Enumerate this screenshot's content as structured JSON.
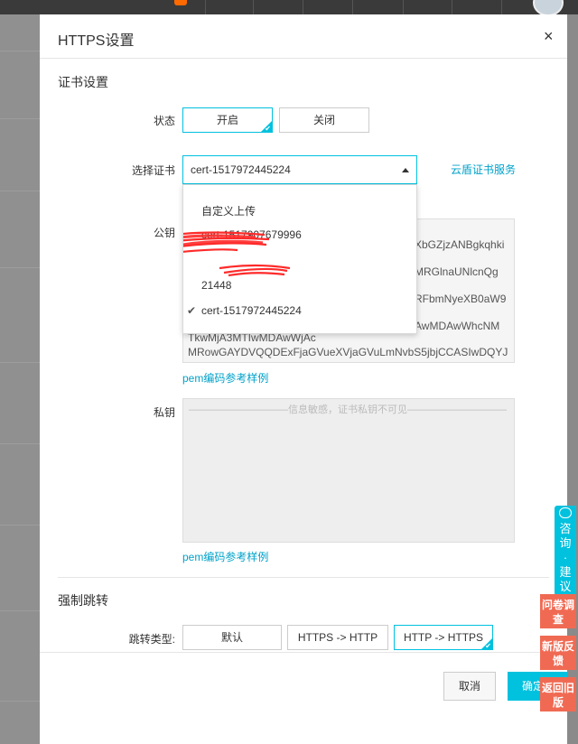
{
  "dialog": {
    "title": "HTTPS设置",
    "close_glyph": "×",
    "cert_section": "证书设置",
    "status_label": "状态",
    "status_on": "开启",
    "status_off": "关闭",
    "select_label": "选择证书",
    "selected_cert": "cert-1517972445224",
    "cloud_link": "云盾证书服务",
    "public_key_label": "公钥",
    "public_key_lines": [
      "XbGZjzANBgkqhki",
      "MRGlnaUNlcnQg",
      "RFbmNyeXB0aW9",
      "AwMDAwWhcNM",
      "TkwMjA3MTIwMDAwWjAc",
      "MRowGAYDVQQDExFjaGVueXVjaGVuLmNvbS5jbjCCASIwDQYJ"
    ],
    "pem_link_1": "pem编码参考样例",
    "private_key_label": "私钥",
    "private_key_placeholder": "——————————信息敏感，证书私钥不可见——————————",
    "pem_link_2": "pem编码参考样例",
    "redirect_section": "强制跳转",
    "redirect_label": "跳转类型:",
    "redirect_default": "默认",
    "redirect_https_http": "HTTPS -> HTTP",
    "redirect_http_https": "HTTP -> HTTPS",
    "cancel": "取消",
    "confirm": "确定"
  },
  "dropdown": {
    "items": [
      "自定义上传",
      "cert-1517907679996",
      "21448",
      "cert-1517972445224"
    ],
    "check_glyph": "✔"
  },
  "float": {
    "consult_chars": [
      "咨",
      "询",
      "·",
      "建",
      "议"
    ],
    "survey": "问卷调查",
    "newver": "新版反馈",
    "oldver": "返回旧版"
  },
  "colors": {
    "accent": "#00c1de",
    "link": "#00a2ca",
    "red_tab": "#f06a53"
  }
}
